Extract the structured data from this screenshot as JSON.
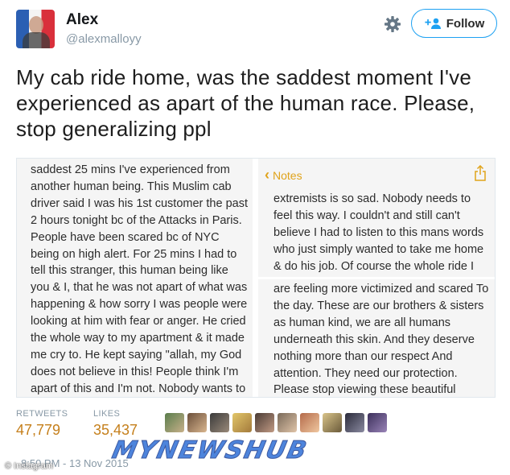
{
  "user": {
    "name": "Alex",
    "handle": "@alexmalloyy"
  },
  "actions": {
    "settings_icon": "gear-icon",
    "follow_label": "Follow",
    "follow_icon": "add-user-icon"
  },
  "tweet": {
    "text": "My cab ride home, was the saddest moment I've experienced as apart of the human race. Please, stop generalizing ppl"
  },
  "photo": {
    "left_note": "saddest 25 mins I've experienced from another human being. This Muslim cab driver said I was his 1st customer the past 2 hours tonight bc of the Attacks in Paris. People have been scared bc of NYC being on high alert. For 25 mins I had to tell this stranger, this human being like you & I, that he was not apart of what was happening & how sorry I was people were looking at him with fear or anger. He cried the whole way to my apartment & it made me cry to. He kept saying \"allah, my God does not believe in this! People think I'm apart of this and I'm not. Nobody wants to drive with me bc they feel unsafe. I can't",
    "notes_header": "Notes",
    "right_top_note": "extremists is so sad. Nobody needs to feel this way. I couldn't and still can't believe I had to listen to this mans words who just simply wanted to take me home & do his job. Of course the whole ride I told this man how I, as many other in this nation",
    "right_bottom_note": "are feeling more victimized and scared To the day. These are our brothers & sisters as human kind, we are all humans underneath this skin. And they deserve nothing more than our respect And attention. They need our protection. Please stop viewing these beautiful humans as enemies bc they are not"
  },
  "stats": {
    "retweets_label": "RETWEETS",
    "retweets_value": "47,779",
    "likes_label": "LIKES",
    "likes_value": "35,437"
  },
  "timestamp": "8:50 PM - 13 Nov 2015",
  "watermark": "MYNEWSHUB",
  "credit": "© Instagram",
  "colors": {
    "accent": "#1da1f2",
    "stat_value": "#c57f1b",
    "notes_accent": "#e0a31a",
    "muted": "#8899a6"
  }
}
